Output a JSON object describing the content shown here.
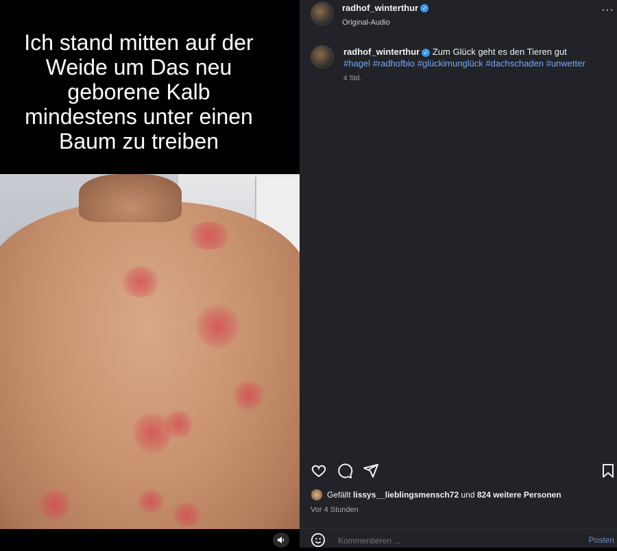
{
  "media": {
    "overlay_text": "Ich stand mitten auf der Weide um Das neu geborene Kalb mindestens unter einen Baum zu treiben",
    "sound_icon": "speaker-icon"
  },
  "header": {
    "username": "radhof_winterthur",
    "audio": "Original-Audio",
    "more_icon": "more-icon"
  },
  "post": {
    "username": "radhof_winterthur",
    "caption": "Zum Glück geht es den Tieren gut",
    "hashtags": "#hagel #radhofbio #glückimunglück #dachschaden #unwetter",
    "time": "4 Std."
  },
  "actions": {
    "icons": [
      "heart-icon",
      "comment-icon",
      "share-icon",
      "bookmark-icon"
    ]
  },
  "likes": {
    "prefix": "Gefällt",
    "user": "lissys__lieblingsmensch72",
    "middle": "und",
    "count": "824 weitere Personen",
    "time": "Vor 4 Stunden"
  },
  "comment": {
    "placeholder": "Kommentieren ...",
    "post_label": "Posten"
  }
}
